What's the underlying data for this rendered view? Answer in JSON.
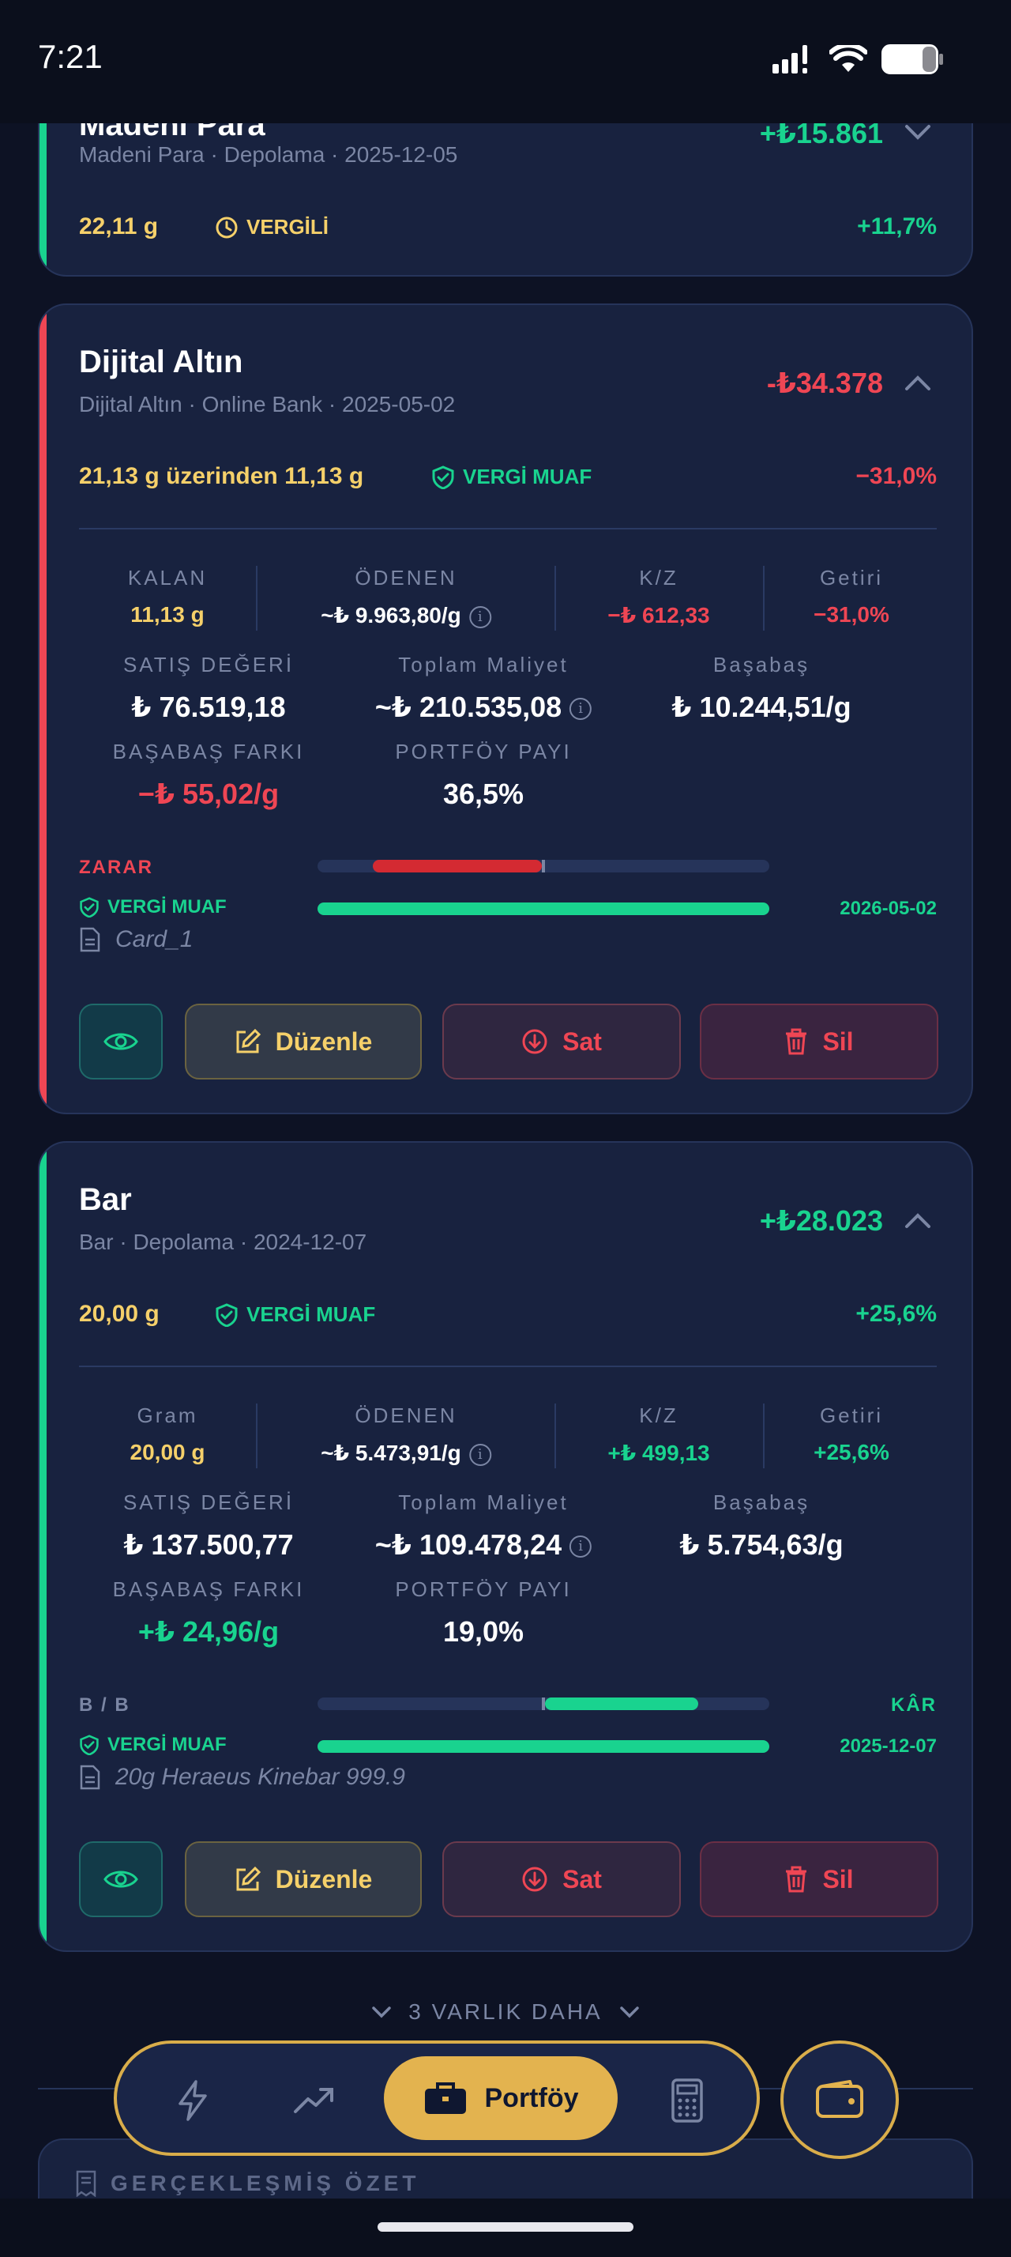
{
  "status_bar": {
    "time": "7:21"
  },
  "cards": [
    {
      "title": "Madeni Para",
      "subtitle": "Madeni Para  ·  Depolama  ·  2025-12-05",
      "amount": "+₺15.861",
      "quantity": "22,11 g",
      "tax_label": "VERGİLİ",
      "percent": "+11,7%",
      "accent": "#19d38f"
    },
    {
      "title": "Dijital Altın",
      "subtitle": "Dijital Altın  ·  Online Bank  ·  2025-05-02",
      "amount": "-₺34.378",
      "quantity": "21,13 g üzerinden 11,13 g",
      "tax_label": "VERGİ MUAF",
      "percent": "−31,0%",
      "accent": "#ef4654",
      "stats_row1": [
        {
          "label": "KALAN",
          "value": "11,13 g"
        },
        {
          "label": "ÖDENEN",
          "value": "~₺ 9.963,80/g"
        },
        {
          "label": "K/Z",
          "value": "−₺ 612,33"
        },
        {
          "label": "Getiri",
          "value": "−31,0%"
        }
      ],
      "stats_row2": [
        {
          "label": "SATIŞ DEĞERİ",
          "value": "₺ 76.519,18"
        },
        {
          "label": "Toplam Maliyet",
          "value": "~₺ 210.535,08"
        },
        {
          "label": "Başabaş",
          "value": "₺ 10.244,51/g"
        }
      ],
      "stats_row3": [
        {
          "label": "BAŞABAŞ FARKI",
          "value": "−₺ 55,02/g"
        },
        {
          "label": "PORTFÖY PAYI",
          "value": "36,5%"
        }
      ],
      "bar_label_left": "ZARAR",
      "bar_label_right": "",
      "tax_bar_label": "VERGİ MUAF",
      "tax_date": "2026-05-02",
      "tax_progress": 1.0,
      "note": "Card_1",
      "buttons": {
        "edit": "Düzenle",
        "sell": "Sat",
        "delete": "Sil"
      }
    },
    {
      "title": "Bar",
      "subtitle": "Bar  ·  Depolama  ·  2024-12-07",
      "amount": "+₺28.023",
      "quantity": "20,00 g",
      "tax_label": "VERGİ MUAF",
      "percent": "+25,6%",
      "accent": "#19d38f",
      "stats_row1": [
        {
          "label": "Gram",
          "value": "20,00 g"
        },
        {
          "label": "ÖDENEN",
          "value": "~₺ 5.473,91/g"
        },
        {
          "label": "K/Z",
          "value": "+₺ 499,13"
        },
        {
          "label": "Getiri",
          "value": "+25,6%"
        }
      ],
      "stats_row2": [
        {
          "label": "SATIŞ DEĞERİ",
          "value": "₺ 137.500,77"
        },
        {
          "label": "Toplam Maliyet",
          "value": "~₺ 109.478,24"
        },
        {
          "label": "Başabaş",
          "value": "₺ 5.754,63/g"
        }
      ],
      "stats_row3": [
        {
          "label": "BAŞABAŞ FARKI",
          "value": "+₺ 24,96/g"
        },
        {
          "label": "PORTFÖY PAYI",
          "value": "19,0%"
        }
      ],
      "bar_label_left": "B / B",
      "bar_label_right": "KÂR",
      "tax_bar_label": "VERGİ MUAF",
      "tax_date": "2025-12-07",
      "tax_progress": 1.0,
      "note": "20g Heraeus Kinebar 999.9",
      "buttons": {
        "edit": "Düzenle",
        "sell": "Sat",
        "delete": "Sil"
      }
    }
  ],
  "more_assets": "3 VARLIK DAHA",
  "summary_label": "GERÇEKLEŞMİŞ ÖZET",
  "nav": {
    "items": [
      {
        "icon": "lightning-icon"
      },
      {
        "icon": "trend-up-icon"
      },
      {
        "icon": "briefcase-icon",
        "label": "Portföy",
        "active": true
      },
      {
        "icon": "calculator-icon"
      }
    ],
    "wallet_icon": "wallet-icon"
  },
  "colors": {
    "profit": "#19d38f",
    "loss": "#ef4654",
    "gold": "#e3b34f",
    "quantity": "#f5d06a"
  }
}
